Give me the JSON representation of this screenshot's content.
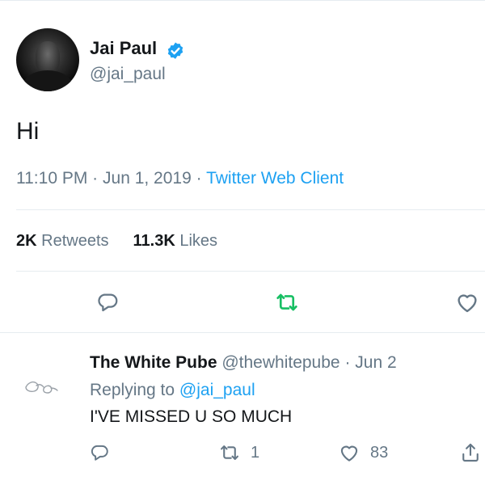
{
  "tweet": {
    "author_name": "Jai Paul",
    "author_handle": "@jai_paul",
    "text": "Hi",
    "time": "11:10 PM",
    "date": "Jun 1, 2019",
    "separator": "·",
    "client": "Twitter Web Client",
    "stats": {
      "retweets_count": "2K",
      "retweets_label": "Retweets",
      "likes_count": "11.3K",
      "likes_label": "Likes"
    },
    "actions": {
      "reply_icon": "reply-icon",
      "retweet_icon": "retweet-icon",
      "like_icon": "heart-icon",
      "retweet_color": "#17bf63"
    }
  },
  "reply": {
    "author_name": "The White Pube",
    "author_handle": "@thewhitepube",
    "separator": "·",
    "date": "Jun 2",
    "replying_label": "Replying to",
    "replying_to": "@jai_paul",
    "text": "I'VE MISSED U SO MUCH",
    "actions": {
      "reply_count": "",
      "retweet_count": "1",
      "like_count": "83"
    }
  },
  "colors": {
    "accent": "#1da1f2",
    "secondary_text": "#657786",
    "primary_text": "#14171a",
    "divider": "#e6ecf0"
  }
}
